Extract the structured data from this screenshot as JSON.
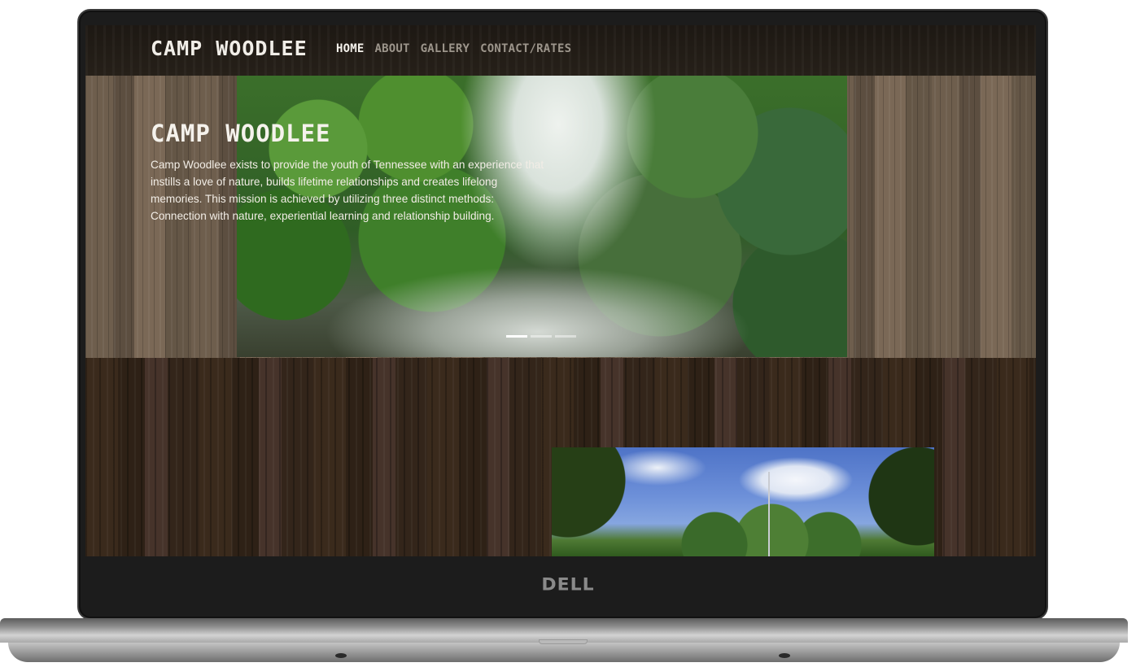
{
  "site": {
    "title": "CAMP WOODLEE",
    "nav": [
      {
        "label": "HOME",
        "active": true
      },
      {
        "label": "ABOUT",
        "active": false
      },
      {
        "label": "GALLERY",
        "active": false
      },
      {
        "label": "CONTACT/RATES",
        "active": false
      }
    ]
  },
  "hero": {
    "slide_count": 3,
    "active_slide": 1
  },
  "content": {
    "heading": "CAMP WOODLEE",
    "paragraph": "Camp Woodlee exists to provide the youth of Tennessee with an experience that instills a love of nature, builds lifetime relationships and creates lifelong memories. This mission is achieved by utilizing three distinct methods: Connection with nature, experiential learning and relationship building."
  },
  "device": {
    "brand_logo": "DELL"
  },
  "colors": {
    "nav_active": "#f5f2ec",
    "nav_inactive": "#9c958b",
    "topbar": "#1d1813"
  }
}
